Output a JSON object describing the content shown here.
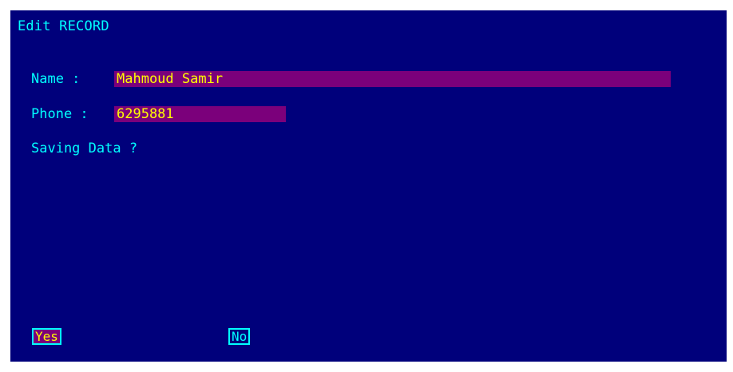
{
  "screen": {
    "title": "Edit RECORD",
    "fields": {
      "name": {
        "label": "Name : ",
        "value": "Mahmoud Samir"
      },
      "phone": {
        "label": "Phone : ",
        "value": "6295881"
      }
    },
    "prompt": "Saving Data ?",
    "buttons": {
      "yes": "Yes",
      "no": "No"
    }
  },
  "colors": {
    "background": "#00007b",
    "text": "#00ffff",
    "field_background": "#7b007b",
    "field_text": "#ffff00"
  }
}
